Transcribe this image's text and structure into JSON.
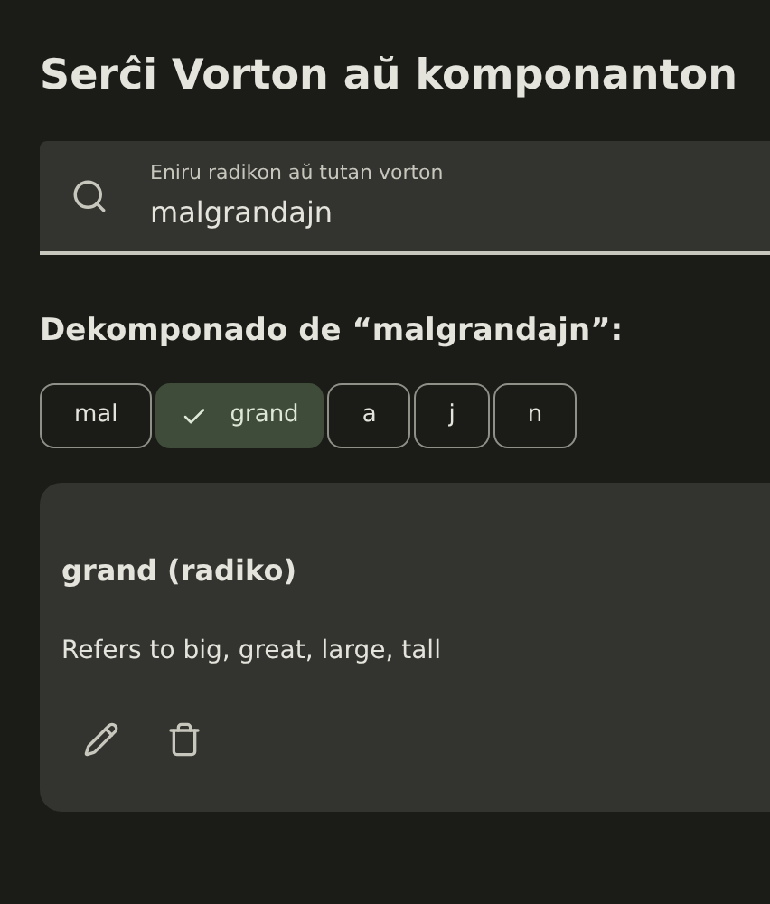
{
  "title": "Serĉi Vorton aŭ komponanton",
  "search": {
    "label": "Eniru radikon aŭ tutan vorton",
    "value": "malgrandajn"
  },
  "decomposition_heading": "Dekomponado de “malgrandajn”:",
  "chips": [
    {
      "label": "mal",
      "selected": false
    },
    {
      "label": "grand",
      "selected": true
    },
    {
      "label": "a",
      "selected": false
    },
    {
      "label": "j",
      "selected": false
    },
    {
      "label": "n",
      "selected": false
    }
  ],
  "card": {
    "title": "grand (radiko)",
    "description": "Refers to big, great, large, tall"
  }
}
